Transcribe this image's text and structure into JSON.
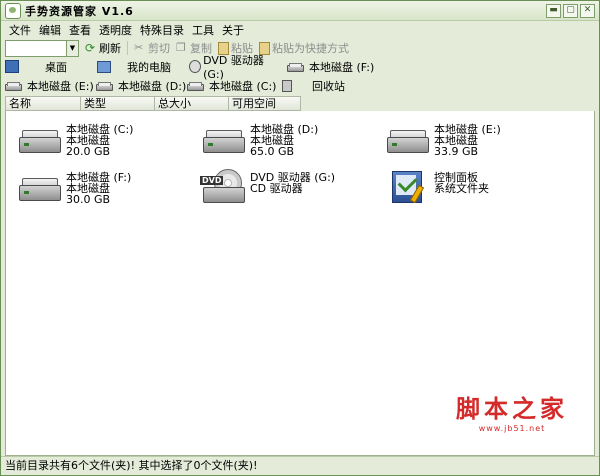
{
  "window": {
    "title": "手势资源管家 V1.6",
    "buttons": [
      "▬",
      "▢",
      "✕"
    ]
  },
  "menu": [
    "文件",
    "编辑",
    "查看",
    "透明度",
    "特殊目录",
    "工具",
    "关于"
  ],
  "toolbar": {
    "address_value": "",
    "refresh": "刷新",
    "cut": "剪切",
    "copy": "复制",
    "paste": "粘贴",
    "paste_shortcut": "粘贴为快捷方式"
  },
  "locations_row1": [
    {
      "label": "桌面",
      "icon": "desktop-icon"
    },
    {
      "label": "我的电脑",
      "icon": "computer-icon"
    },
    {
      "label": "DVD 驱动器 (G:)",
      "icon": "dvd-drive-icon"
    },
    {
      "label": "本地磁盘 (F:)",
      "icon": "hard-drive-icon"
    }
  ],
  "locations_row2": [
    {
      "label": "本地磁盘 (E:)",
      "icon": "hard-drive-icon"
    },
    {
      "label": "本地磁盘 (D:)",
      "icon": "hard-drive-icon"
    },
    {
      "label": "本地磁盘 (C:)",
      "icon": "hard-drive-icon"
    },
    {
      "label": "回收站",
      "icon": "recycle-bin-icon"
    }
  ],
  "columns": [
    "名称",
    "类型",
    "总大小",
    "可用空间"
  ],
  "items": [
    {
      "name": "本地磁盘 (C:)",
      "type": "本地磁盘",
      "size": "20.0 GB",
      "icon": "hard-drive-icon"
    },
    {
      "name": "本地磁盘 (D:)",
      "type": "本地磁盘",
      "size": "65.0 GB",
      "icon": "hard-drive-icon"
    },
    {
      "name": "本地磁盘 (E:)",
      "type": "本地磁盘",
      "size": "33.9 GB",
      "icon": "hard-drive-icon"
    },
    {
      "name": "本地磁盘 (F:)",
      "type": "本地磁盘",
      "size": "30.0 GB",
      "icon": "hard-drive-icon"
    },
    {
      "name": "DVD 驱动器 (G:)",
      "type": "CD 驱动器",
      "size": "",
      "icon": "dvd-drive-icon"
    },
    {
      "name": "控制面板",
      "type": "系统文件夹",
      "size": "",
      "icon": "control-panel-icon"
    }
  ],
  "status": "当前目录共有6个文件(夹)! 其中选择了0个文件(夹)!",
  "watermark": {
    "title": "脚本之家",
    "url": "www.jb51.net"
  }
}
